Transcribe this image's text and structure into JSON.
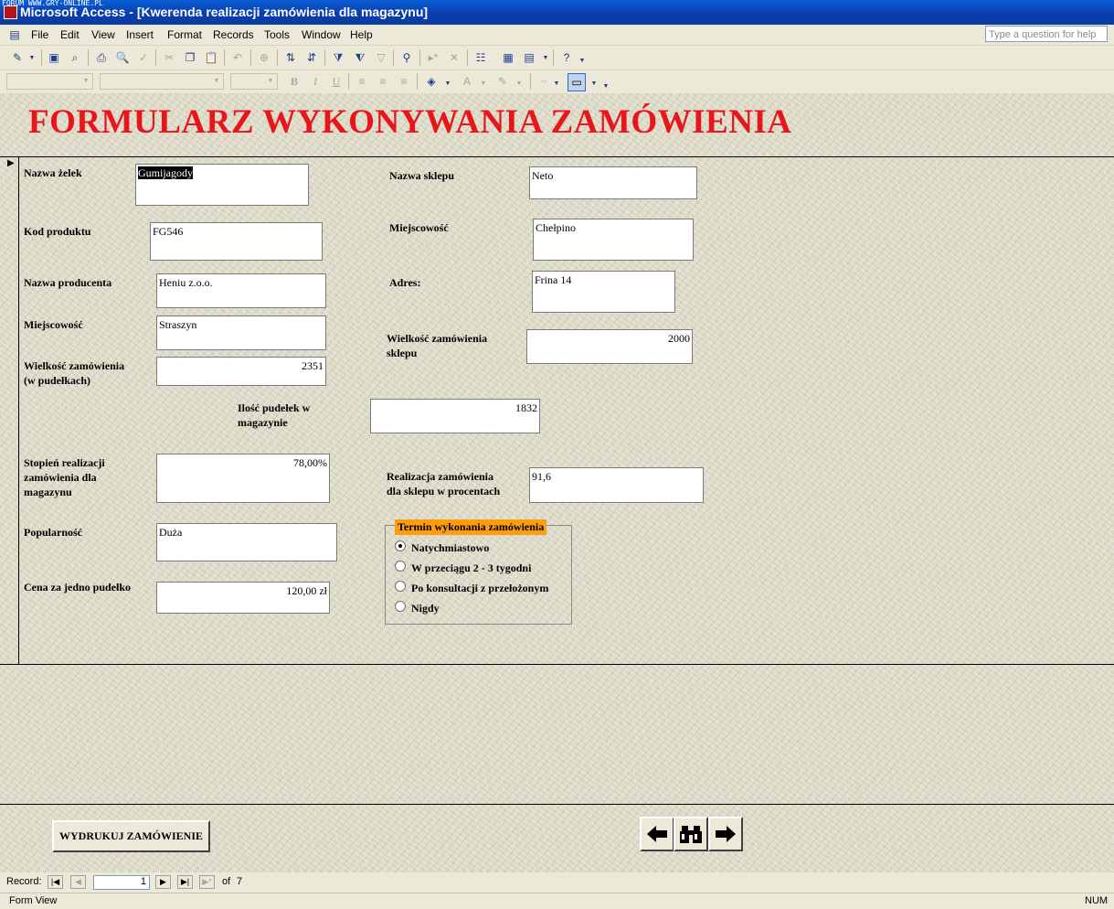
{
  "window": {
    "watermark": "FORUM WWW.GRY-ONLINE.PL",
    "title": "Microsoft Access - [Kwerenda realizacji zamówienia dla magazynu]"
  },
  "menu": {
    "items": [
      "File",
      "Edit",
      "View",
      "Insert",
      "Format",
      "Records",
      "Tools",
      "Window",
      "Help"
    ],
    "help_placeholder": "Type a question for help"
  },
  "form": {
    "title": "FORMULARZ WYKONYWANIA ZAMÓWIENIA",
    "left_fields": {
      "nazwa_zelek": {
        "label": "Nazwa żelek",
        "value": "Gumijagody"
      },
      "kod_produktu": {
        "label": "Kod produktu",
        "value": "FG546"
      },
      "nazwa_producenta": {
        "label": "Nazwa producenta",
        "value": "Heniu z.o.o."
      },
      "miejscowosc": {
        "label": "Miejscowość",
        "value": "Straszyn"
      },
      "wielkosc_zamowienia": {
        "label_line1": "Wielkość zamówienia",
        "label_line2": "(w pudełkach)",
        "value": "2351"
      },
      "stopien_realizacji": {
        "label_line1": "Stopień realizacji",
        "label_line2": "zamówienia dla",
        "label_line3": "magazynu",
        "value": "78,00%"
      },
      "popularnosc": {
        "label": "Popularność",
        "value": "Duża"
      },
      "cena": {
        "label": "Cena za jedno pudełko",
        "value": "120,00 zł"
      }
    },
    "center_fields": {
      "ilosc_pudelek": {
        "label_line1": "Ilość pudełek w",
        "label_line2": "magazynie",
        "value": "1832"
      }
    },
    "right_fields": {
      "nazwa_sklepu": {
        "label": "Nazwa sklepu",
        "value": "Neto"
      },
      "miejscowosc": {
        "label": "Miejscowość",
        "value": "Chełpino"
      },
      "adres": {
        "label": "Adres:",
        "value": "Frina 14"
      },
      "wielkosc_zamowienia_sklepu": {
        "label_line1": "Wielkość zamówienia",
        "label_line2": "sklepu",
        "value": "2000"
      },
      "realizacja_procent": {
        "label_line1": "Realizacja zamówienia",
        "label_line2": "dla sklepu w procentach",
        "value": "91,6"
      }
    },
    "option_group": {
      "label": "Termin wykonania zamówienia",
      "options": [
        "Natychmiastowo",
        "W przeciągu 2 - 3 tygodni",
        "Po konsultacji z przełożonym",
        "Nigdy"
      ],
      "selected": "Natychmiastowo"
    },
    "buttons": {
      "print": "WYDRUKUJ ZAMÓWIENIE",
      "prev_icon": "arrow-left-icon",
      "find_icon": "binoculars-icon",
      "next_icon": "arrow-right-icon"
    }
  },
  "record_nav": {
    "label": "Record:",
    "current": "1",
    "of_label": "of",
    "total": "7"
  },
  "status": {
    "mode": "Form View",
    "num": "NUM"
  }
}
